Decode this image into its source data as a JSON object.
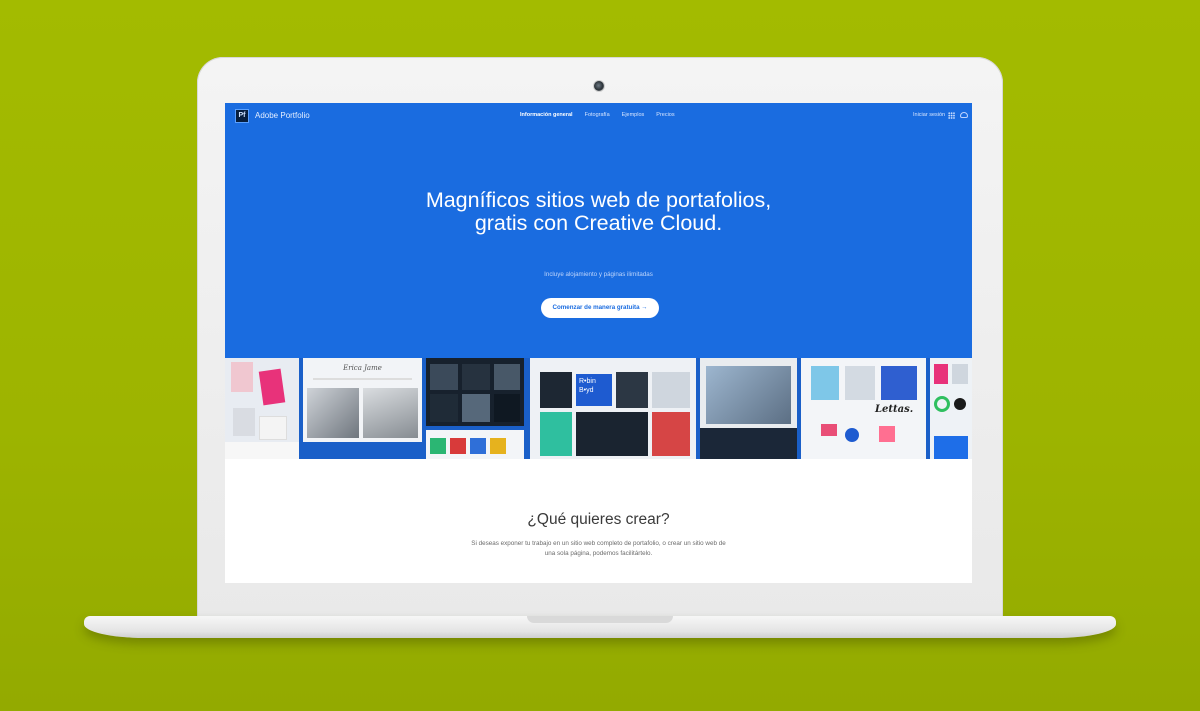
{
  "nav": {
    "logo_badge": "Pf",
    "logo_text": "Adobe Portfolio",
    "links": [
      "Información general",
      "Fotografía",
      "Ejemplos",
      "Precios"
    ],
    "signin": "Iniciar sesión"
  },
  "hero": {
    "title": "Magníficos sitios web de portafolios, gratis con Creative Cloud.",
    "subtitle": "Incluye alojamiento y páginas ilimitadas",
    "cta": "Comenzar de manera gratuita →"
  },
  "gallery": {
    "script_title": "Erica Jame",
    "robin_boyd": "R•bin B•yd",
    "lettering": "Lettas."
  },
  "section": {
    "title": "¿Qué quieres crear?",
    "description": "Si deseas exponer tu trabajo en un sitio web completo de portafolio, o crear un sitio web de una sola página, podemos facilitártelo."
  },
  "colors": {
    "background": "#a3bb00",
    "hero_blue": "#1a6ce0",
    "cta_text": "#1a6ce0"
  },
  "icons": [
    "grid-icon",
    "cloud-icon",
    "webcam"
  ]
}
